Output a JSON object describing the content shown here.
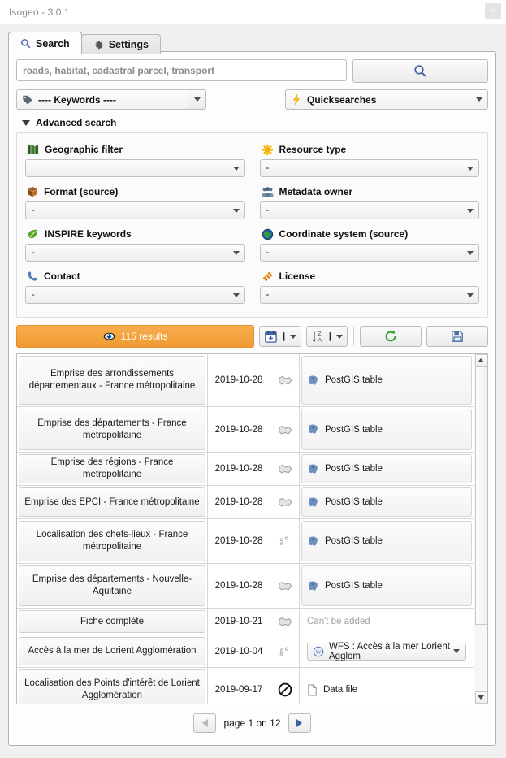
{
  "window": {
    "title": "Isogeo - 3.0.1",
    "close_label": "✕"
  },
  "tabs": [
    {
      "label": "Search",
      "icon": "search-icon",
      "active": true
    },
    {
      "label": "Settings",
      "icon": "gear-icon",
      "active": false
    }
  ],
  "search": {
    "placeholder": "roads, habitat, cadastral parcel, transport",
    "value": "",
    "button_icon": "magnifier-icon"
  },
  "keywords": {
    "label": "---- Keywords ----",
    "icon": "tag-icon"
  },
  "quicksearches": {
    "label": "Quicksearches",
    "icon": "lightning-icon"
  },
  "advanced": {
    "title": "Advanced search",
    "expanded": true,
    "filters": [
      {
        "label": "Geographic filter",
        "icon": "map-icon",
        "value": ""
      },
      {
        "label": "Resource type",
        "icon": "asterisk-icon",
        "value": "-"
      },
      {
        "label": "Format (source)",
        "icon": "box-icon",
        "value": "-"
      },
      {
        "label": "Metadata owner",
        "icon": "users-icon",
        "value": "-"
      },
      {
        "label": "INSPIRE keywords",
        "icon": "leaf-icon",
        "value": "-"
      },
      {
        "label": "Coordinate system (source)",
        "icon": "globe-icon",
        "value": "-"
      },
      {
        "label": "Contact",
        "icon": "phone-icon",
        "value": "-"
      },
      {
        "label": "License",
        "icon": "hammer-icon",
        "value": "-"
      }
    ]
  },
  "results_toolbar": {
    "results_label": "115 results",
    "results_icon": "eye-icon",
    "date_filter_icon": "calendar-plus-icon",
    "sort_icon": "sort-za-icon",
    "reset_icon": "reset-arrow-icon",
    "save_icon": "floppy-disk-icon"
  },
  "results_table": {
    "rows": [
      {
        "title": "Emprise des arrondissements départementaux - France métropolitaine",
        "date": "2019-10-28",
        "geometry": "polygon-icon",
        "format": "PostGIS table",
        "format_icon": "postgis-icon",
        "format_style": "button"
      },
      {
        "title": "Emprise des départements - France métropolitaine",
        "date": "2019-10-28",
        "geometry": "polygon-icon",
        "format": "PostGIS table",
        "format_icon": "postgis-icon",
        "format_style": "button"
      },
      {
        "title": "Emprise des régions - France métropolitaine",
        "date": "2019-10-28",
        "geometry": "polygon-icon",
        "format": "PostGIS table",
        "format_icon": "postgis-icon",
        "format_style": "button"
      },
      {
        "title": "Emprise des EPCI - France métropolitaine",
        "date": "2019-10-28",
        "geometry": "polygon-icon",
        "format": "PostGIS table",
        "format_icon": "postgis-icon",
        "format_style": "button"
      },
      {
        "title": "Localisation des chefs-lieux - France métropolitaine",
        "date": "2019-10-28",
        "geometry": "point-icon",
        "format": "PostGIS table",
        "format_icon": "postgis-icon",
        "format_style": "button"
      },
      {
        "title": "Emprise des départements - Nouvelle-Aquitaine",
        "date": "2019-10-28",
        "geometry": "polygon-icon",
        "format": "PostGIS table",
        "format_icon": "postgis-icon",
        "format_style": "button"
      },
      {
        "title": "Fiche complète",
        "date": "2019-10-21",
        "geometry": "polygon-icon",
        "format": "Can't be added",
        "format_icon": "none",
        "format_style": "disabled"
      },
      {
        "title": "Accès à la mer de Lorient Agglomération",
        "date": "2019-10-04",
        "geometry": "point-icon",
        "format": "WFS : Accès à la mer Lorient Agglom",
        "format_icon": "wfs-icon",
        "format_style": "dropdown"
      },
      {
        "title": "Localisation des Points d'intérêt de Lorient Agglomération",
        "date": "2019-09-17",
        "geometry": "no-geometry-icon",
        "format": "Data file",
        "format_icon": "file-icon",
        "format_style": "plain"
      }
    ]
  },
  "pagination": {
    "label": "page 1 on 12",
    "prev_icon": "triangle-left-icon",
    "next_icon": "triangle-right-icon"
  },
  "colors": {
    "accent_orange": "#f19a34",
    "link_blue": "#3d5fa6",
    "panel_bg": "#fdfdfd",
    "window_bg": "#f0f0f0"
  }
}
